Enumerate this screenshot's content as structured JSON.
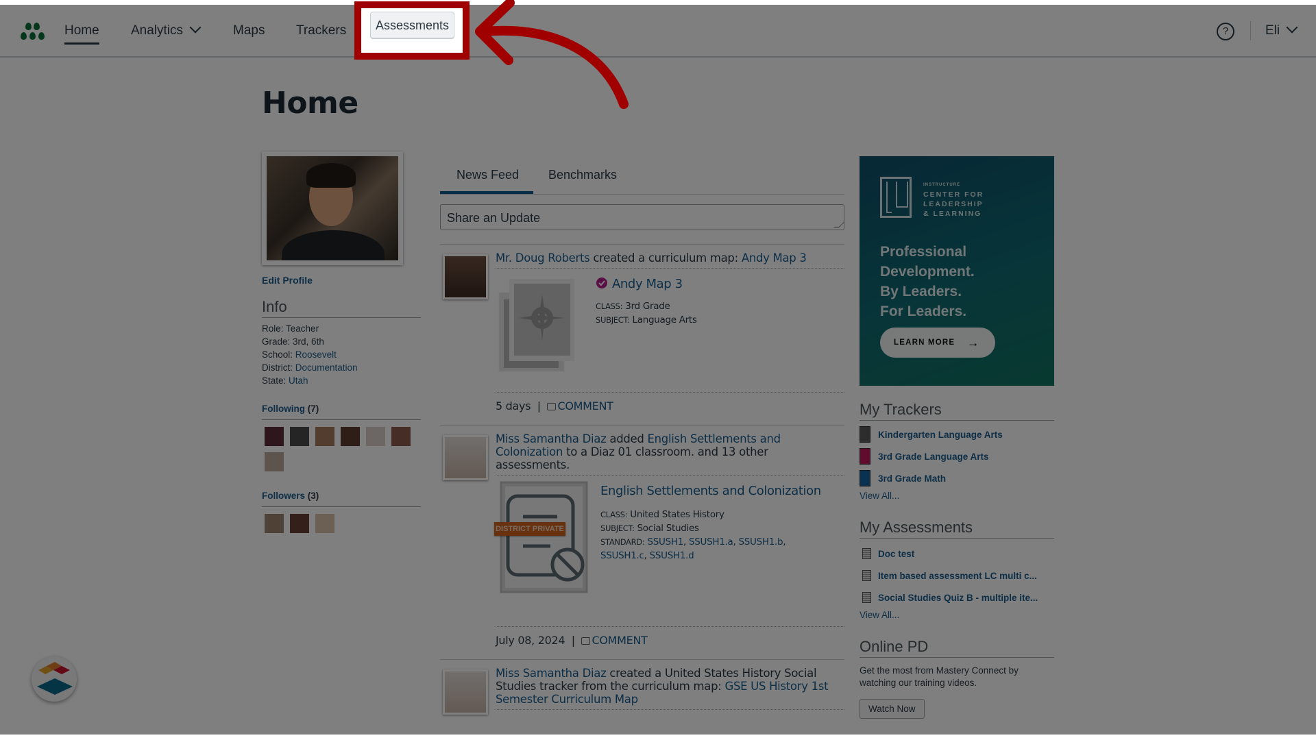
{
  "nav": {
    "items": [
      {
        "label": "Home",
        "active": true
      },
      {
        "label": "Analytics",
        "has_dropdown": true
      },
      {
        "label": "Maps"
      },
      {
        "label": "Trackers"
      },
      {
        "label": "Assessments",
        "highlighted": true
      }
    ],
    "help_icon": "question-circle-icon",
    "user": "Eli"
  },
  "page_title": "Home",
  "profile": {
    "edit_label": "Edit Profile",
    "info_heading": "Info",
    "info": {
      "role_label": "Role:",
      "role": "Teacher",
      "grade_label": "Grade:",
      "grade": "3rd, 6th",
      "school_label": "School:",
      "school": "Roosevelt",
      "district_label": "District:",
      "district": "Documentation",
      "state_label": "State:",
      "state": "Utah"
    },
    "following_label": "Following",
    "following_count": "(7)",
    "followers_label": "Followers",
    "followers_count": "(3)"
  },
  "feed": {
    "tabs": [
      "News Feed",
      "Benchmarks"
    ],
    "share_placeholder": "Share an Update",
    "posts": [
      {
        "author": "Mr. Doug Roberts",
        "action": " created a curriculum map: ",
        "target": "Andy Map 3",
        "attachment_title": "Andy Map 3",
        "class_label": "CLASS:",
        "class": "3rd Grade",
        "subject_label": "SUBJECT:",
        "subject": "Language Arts",
        "time": "5 days",
        "comment": "COMMENT"
      },
      {
        "author": "Miss Samantha Diaz",
        "action1": " added ",
        "target": "English Settlements and Colonization",
        "action2": " to a Diaz 01 classroom. and 13 other assessments.",
        "badge": "DISTRICT PRIVATE",
        "attachment_title": "English Settlements and Colonization",
        "class_label": "CLASS:",
        "class": "United States History",
        "subject_label": "SUBJECT:",
        "subject": "Social Studies",
        "standard_label": "STANDARD:",
        "standards": [
          "SSUSH1",
          "SSUSH1.a",
          "SSUSH1.b",
          "SSUSH1.c",
          "SSUSH1.d"
        ],
        "time": "July 08, 2024",
        "comment": "COMMENT"
      },
      {
        "author": "Miss Samantha Diaz",
        "action": " created a United States History Social Studies tracker from the curriculum map: ",
        "target": "GSE US History 1st Semester Curriculum Map"
      }
    ]
  },
  "ad": {
    "org_small": "INSTRUCTURE",
    "org_lines": [
      "CENTER FOR",
      "LEADERSHIP",
      "& LEARNING"
    ],
    "headline": [
      "Professional",
      "Development.",
      "By Leaders.",
      "For Leaders."
    ],
    "button": "LEARN MORE"
  },
  "trackers": {
    "heading": "My Trackers",
    "items": [
      {
        "label": "Kindergarten Language Arts",
        "color": "#5a5a5a"
      },
      {
        "label": "3rd Grade Language Arts",
        "color": "#c2185b"
      },
      {
        "label": "3rd Grade Math",
        "color": "#1565a0"
      }
    ],
    "view_all": "View All..."
  },
  "assessments": {
    "heading": "My Assessments",
    "items": [
      {
        "label": "Doc test"
      },
      {
        "label": "Item based assessment LC multi c..."
      },
      {
        "label": "Social Studies Quiz B - multiple ite..."
      }
    ],
    "view_all": "View All..."
  },
  "online_pd": {
    "heading": "Online PD",
    "text": "Get the most from Mastery Connect by watching our training videos.",
    "button": "Watch Now"
  },
  "colors": {
    "accent": "#1a5d8f",
    "annotation": "#a00000",
    "logo_green": "#0b6e3b",
    "badge_orange": "#d2641e"
  }
}
